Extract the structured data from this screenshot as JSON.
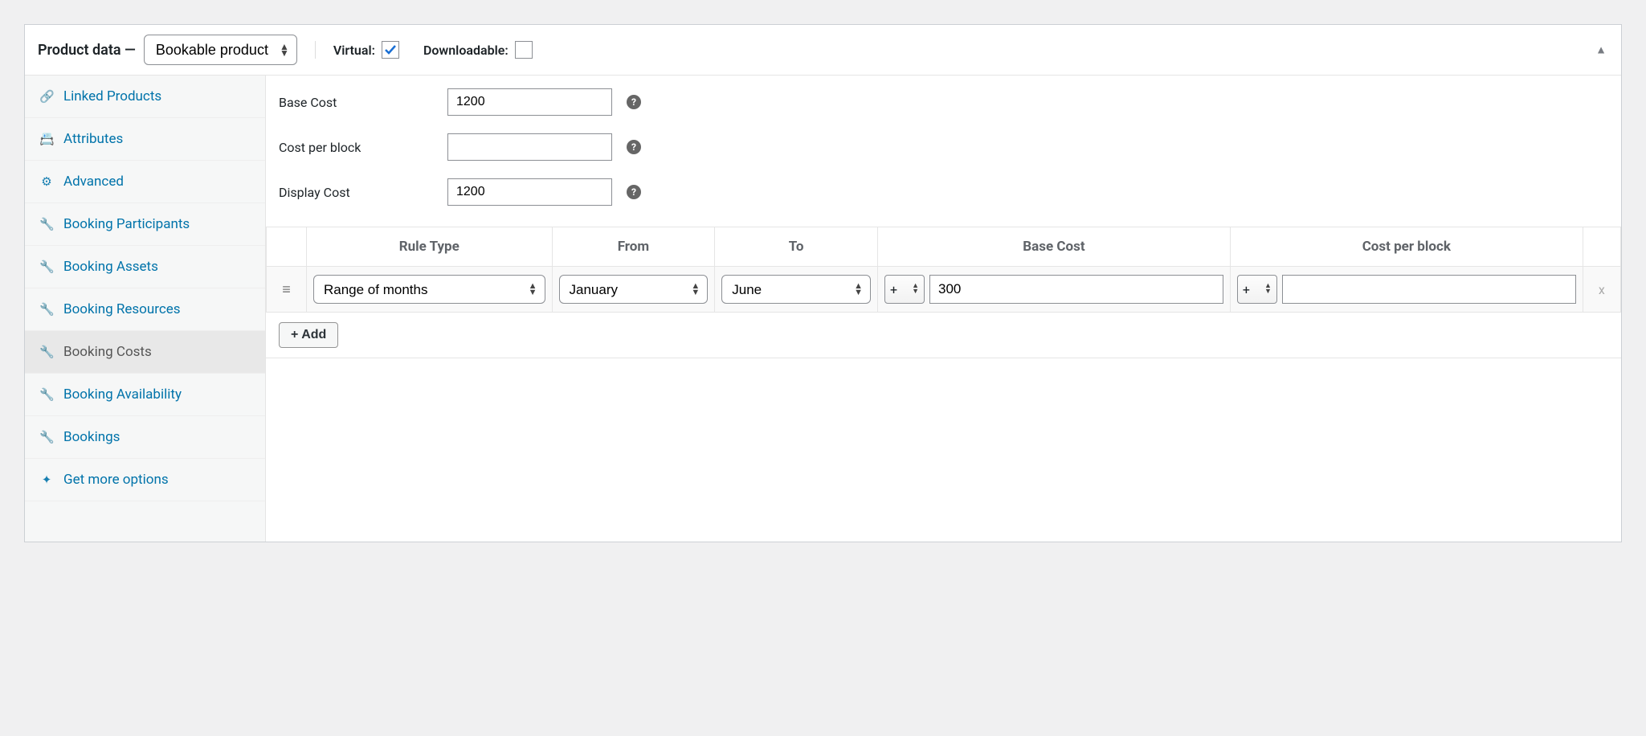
{
  "header": {
    "title_prefix": "Product data —",
    "product_type": "Bookable product",
    "virtual_label": "Virtual:",
    "virtual_checked": true,
    "downloadable_label": "Downloadable:",
    "downloadable_checked": false
  },
  "tabs": [
    {
      "id": "linked-products",
      "label": "Linked Products",
      "icon": "🔗"
    },
    {
      "id": "attributes",
      "label": "Attributes",
      "icon": "📇"
    },
    {
      "id": "advanced",
      "label": "Advanced",
      "icon": "⚙"
    },
    {
      "id": "booking-participants",
      "label": "Booking Participants",
      "icon": "🔧"
    },
    {
      "id": "booking-assets",
      "label": "Booking Assets",
      "icon": "🔧"
    },
    {
      "id": "booking-resources",
      "label": "Booking Resources",
      "icon": "🔧"
    },
    {
      "id": "booking-costs",
      "label": "Booking Costs",
      "icon": "🔧",
      "active": true
    },
    {
      "id": "booking-availability",
      "label": "Booking Availability",
      "icon": "🔧"
    },
    {
      "id": "bookings",
      "label": "Bookings",
      "icon": "🔧"
    },
    {
      "id": "get-more-options",
      "label": "Get more options",
      "icon": "✦"
    }
  ],
  "fields": {
    "base_cost": {
      "label": "Base Cost",
      "value": "1200"
    },
    "cost_per_block": {
      "label": "Cost per block",
      "value": ""
    },
    "display_cost": {
      "label": "Display Cost",
      "value": "1200"
    }
  },
  "rules_table": {
    "columns": {
      "rule_type": "Rule Type",
      "from": "From",
      "to": "To",
      "base_cost": "Base Cost",
      "cost_per_block": "Cost per block"
    },
    "rows": [
      {
        "rule_type": "Range of months",
        "from": "January",
        "to": "June",
        "base_cost_op": "+",
        "base_cost_value": "300",
        "cpb_op": "+",
        "cpb_value": ""
      }
    ]
  },
  "buttons": {
    "add": "+ Add",
    "remove_row": "x"
  }
}
